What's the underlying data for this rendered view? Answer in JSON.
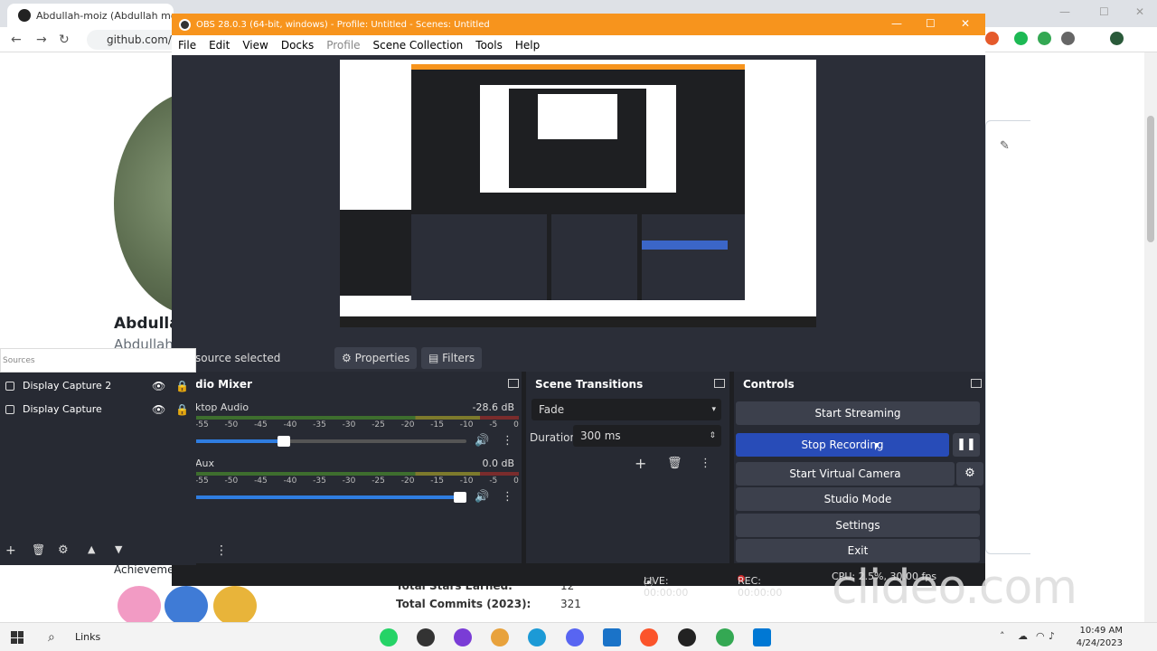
{
  "browser": {
    "tab_title": "Abdullah-moiz (Abdullah moiz)",
    "url": "github.com/A",
    "profile_name": "Abdulla",
    "profile_user": "Abdullah",
    "achievements": "Achieveme",
    "stats": [
      {
        "label": "Total Stars Earned:",
        "value": "12"
      },
      {
        "label": "Total Commits (2023):",
        "value": "321"
      }
    ]
  },
  "obs": {
    "title": "OBS 28.0.3 (64-bit, windows) - Profile: Untitled - Scenes: Untitled",
    "menu": [
      "File",
      "Edit",
      "View",
      "Docks",
      "Profile",
      "Scene Collection",
      "Tools",
      "Help"
    ],
    "selection": {
      "text": "source selected",
      "properties": "Properties",
      "filters": "Filters"
    },
    "sources": {
      "header": "Sources",
      "items": [
        "Display Capture 2",
        "Display Capture"
      ]
    },
    "mixer": {
      "title": "dio Mixer",
      "ticks": [
        "-55",
        "-50",
        "-45",
        "-40",
        "-35",
        "-30",
        "-25",
        "-20",
        "-15",
        "-10",
        "-5",
        "0"
      ],
      "channels": [
        {
          "name": "ktop Audio",
          "db": "-28.6 dB",
          "volume": 0.35
        },
        {
          "name": "Aux",
          "db": "0.0 dB",
          "volume": 1.0
        }
      ]
    },
    "transitions": {
      "title": "Scene Transitions",
      "selected": "Fade",
      "duration_label": "Duration",
      "duration_value": "300 ms"
    },
    "controls": {
      "title": "Controls",
      "start_streaming": "Start Streaming",
      "stop_recording": "Stop Recording",
      "start_virtual_camera": "Start Virtual Camera",
      "studio_mode": "Studio Mode",
      "settings": "Settings",
      "exit": "Exit"
    },
    "status": {
      "live": "LIVE: 00:00:00",
      "rec": "REC: 00:00:00",
      "cpu": "CPU: 2.5%, 30.00 fps"
    }
  },
  "taskbar": {
    "links": "Links",
    "time": "10:49 AM",
    "date": "4/24/2023"
  },
  "watermark": "clideo.com"
}
